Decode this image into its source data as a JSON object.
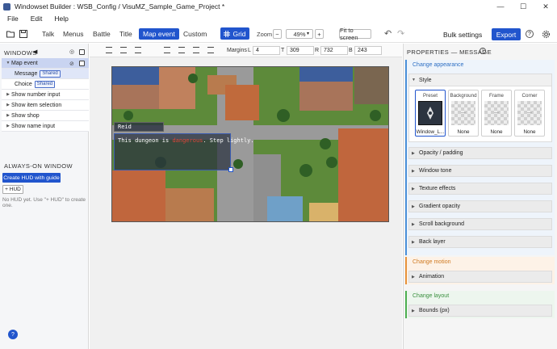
{
  "window": {
    "title": "Windowset Builder : WSB_Config / VisuMZ_Sample_Game_Project *",
    "minimize": "—",
    "maximize": "☐",
    "close": "✕"
  },
  "menu": [
    "File",
    "Edit",
    "Help"
  ],
  "toolbar": {
    "tabs": [
      "Talk",
      "Menus",
      "Battle",
      "Title",
      "Map event",
      "Custom"
    ],
    "active_tab": "Map event",
    "grid_label": "Grid",
    "zoom_label": "Zoom",
    "zoom_minus": "−",
    "zoom_value": "49%",
    "zoom_dropdown": "▾",
    "zoom_plus": "+",
    "fit_label": "Fit to screen",
    "undo": "↶",
    "redo": "↷",
    "bulk_label": "Bulk settings",
    "export_label": "Export",
    "help": "?",
    "accent": "#2155cd"
  },
  "left": {
    "windows_title": "WINDOWS",
    "items": [
      {
        "label": "Map event",
        "expanded": true
      },
      {
        "label": "Message",
        "badge": "Shared"
      },
      {
        "label": "Choice",
        "badge": "Shared"
      },
      {
        "label": "Show number input"
      },
      {
        "label": "Show item selection"
      },
      {
        "label": "Show shop"
      },
      {
        "label": "Show name input"
      }
    ],
    "always_on_title": "ALWAYS-ON WINDOW",
    "create_hud_label": "Create HUD with guide",
    "plus_hud_label": "+ HUD",
    "no_hud_text": "No HUD yet. Use \"+ HUD\" to create one.",
    "help_fab": "?"
  },
  "margins": {
    "label": "Margins",
    "fields": [
      {
        "key": "L",
        "value": "4"
      },
      {
        "key": "T",
        "value": "309"
      },
      {
        "key": "R",
        "value": "732"
      },
      {
        "key": "B",
        "value": "243"
      }
    ]
  },
  "preview": {
    "speaker": "Reid",
    "msg_before": "This dungeon is ",
    "msg_highlight": "dangerous",
    "msg_after": ". Step lightly."
  },
  "right": {
    "title": "PROPERTIES — MESSAGE",
    "change_appearance": "Change appearance",
    "style_label": "Style",
    "cards": [
      {
        "label": "Preset",
        "value": "Window_L..."
      },
      {
        "label": "Background",
        "value": "None"
      },
      {
        "label": "Frame",
        "value": "None"
      },
      {
        "label": "Corner",
        "value": "None"
      }
    ],
    "appearance_sections": [
      "Opacity / padding",
      "Window tone",
      "Texture effects",
      "Gradient opacity",
      "Scroll background",
      "Back layer"
    ],
    "change_motion": "Change motion",
    "motion_sections": [
      "Animation"
    ],
    "change_layout": "Change layout",
    "layout_sections": [
      "Bounds (px)"
    ],
    "colors": {
      "appearance": "#4a90d9",
      "motion": "#e8923a",
      "layout": "#4caf50"
    }
  }
}
